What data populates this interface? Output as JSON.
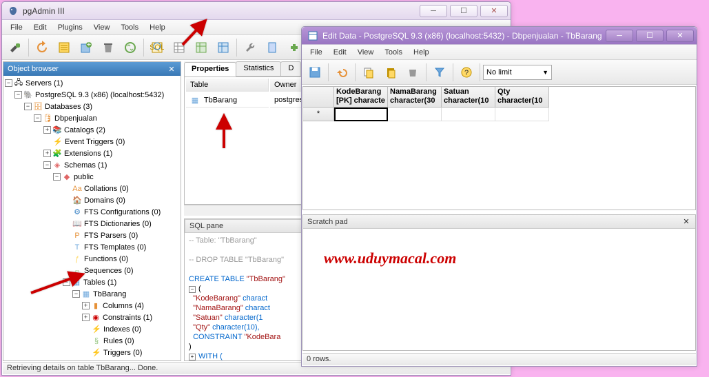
{
  "main_window": {
    "title": "pgAdmin III",
    "menu": [
      "File",
      "Edit",
      "Plugins",
      "View",
      "Tools",
      "Help"
    ],
    "statusbar": "Retrieving details on table TbBarang... Done."
  },
  "object_browser": {
    "title": "Object browser",
    "servers_label": "Servers (1)",
    "pg": "PostgreSQL 9.3 (x86) (localhost:5432)",
    "databases": "Databases (3)",
    "db": "Dbpenjualan",
    "catalogs": "Catalogs (2)",
    "event_triggers": "Event Triggers (0)",
    "extensions": "Extensions (1)",
    "schemas": "Schemas (1)",
    "public": "public",
    "collations": "Collations (0)",
    "domains": "Domains (0)",
    "fts_conf": "FTS Configurations (0)",
    "fts_dict": "FTS Dictionaries (0)",
    "fts_parsers": "FTS Parsers (0)",
    "fts_templates": "FTS Templates (0)",
    "functions": "Functions (0)",
    "sequences": "Sequences (0)",
    "tables": "Tables (1)",
    "tbbarang": "TbBarang",
    "columns": "Columns (4)",
    "constraints": "Constraints (1)",
    "indexes": "Indexes (0)",
    "rules": "Rules (0)",
    "triggers": "Triggers (0)"
  },
  "properties_panel": {
    "tabs": [
      "Properties",
      "Statistics",
      "D"
    ],
    "col_table": "Table",
    "col_owner": "Owner",
    "row_table": "TbBarang",
    "row_owner": "postgres"
  },
  "sql_panel": {
    "title": "SQL pane",
    "l1": "-- Table: \"TbBarang\"",
    "l2": "-- DROP TABLE \"TbBarang\"",
    "l3a": "CREATE TABLE ",
    "l3b": "\"TbBarang\"",
    "l4": "(",
    "l5a": "  \"KodeBarang\"",
    "l5b": " charact",
    "l6a": "  \"NamaBarang\"",
    "l6b": " charact",
    "l7a": "  \"Satuan\"",
    "l7b": " character(1",
    "l8a": "  \"Qty\"",
    "l8b": " character(10),",
    "l9a": "  CONSTRAINT ",
    "l9b": "\"KodeBara",
    "l10": "WITH ("
  },
  "edit_window": {
    "title": "Edit Data - PostgreSQL 9.3 (x86) (localhost:5432) - Dbpenjualan - TbBarang",
    "menu": [
      "File",
      "Edit",
      "View",
      "Tools",
      "Help"
    ],
    "limit_label": "No limit",
    "cols": [
      {
        "h1": "KodeBarang",
        "h2": "[PK] characte"
      },
      {
        "h1": "NamaBarang",
        "h2": "character(30"
      },
      {
        "h1": "Satuan",
        "h2": "character(10"
      },
      {
        "h1": "Qty",
        "h2": "character(10"
      }
    ],
    "row_marker": "*",
    "scratch_title": "Scratch pad",
    "watermark": "www.uduymacal.com",
    "status": "0 rows."
  }
}
